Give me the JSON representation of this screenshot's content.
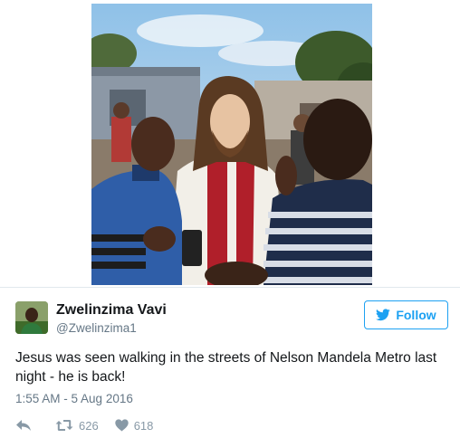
{
  "tweet": {
    "author_name": "Zwelinzima Vavi",
    "author_handle": "@Zwelinzima1",
    "follow_label": "Follow",
    "text": "Jesus was seen walking in the streets of Nelson Mandela Metro last night - he is back!",
    "timestamp": "1:55 AM - 5 Aug 2016",
    "retweet_count": "626",
    "like_count": "618"
  },
  "colors": {
    "accent": "#1da1f2",
    "muted": "#657786",
    "icon": "#8899a6",
    "text": "#14171a"
  },
  "icons": [
    "twitter-bird-icon",
    "reply-icon",
    "retweet-icon",
    "heart-icon"
  ]
}
